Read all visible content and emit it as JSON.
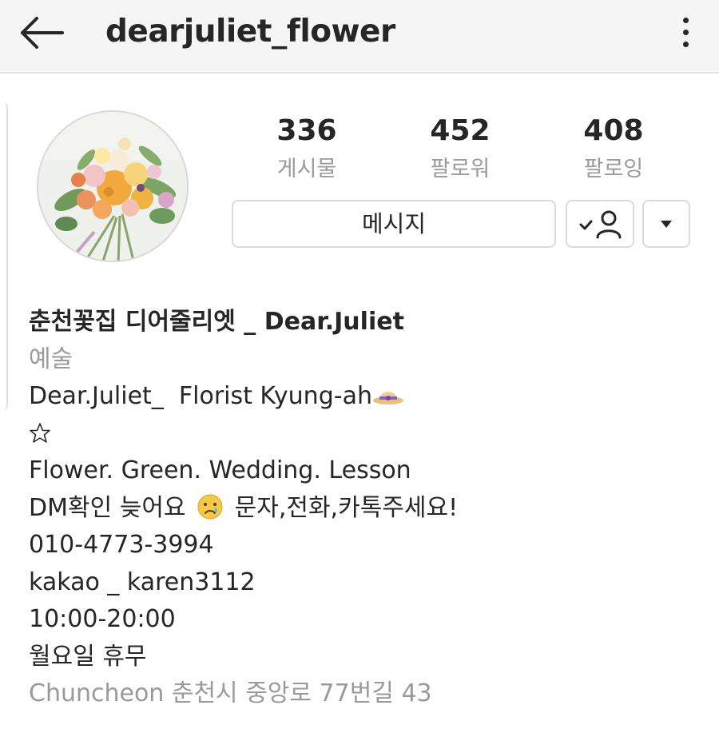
{
  "header": {
    "username": "dearjuliet_flower",
    "back_icon": "arrow-left-icon",
    "more_icon": "more-vertical-icon"
  },
  "profile": {
    "avatar_desc": "flower bouquet photo",
    "stats": [
      {
        "value": "336",
        "label": "게시물"
      },
      {
        "value": "452",
        "label": "팔로워"
      },
      {
        "value": "408",
        "label": "팔로잉"
      }
    ],
    "message_button": "메시지",
    "following_icon": "person-check-icon",
    "dropdown_icon": "triangle-down-icon"
  },
  "bio": {
    "name": "춘천꽃집 디어줄리엣 _ Dear.Juliet",
    "category": "예술",
    "line1": "Dear.Juliet_  Florist Kyung-ah",
    "hat_emoji_icon": "sun-hat-emoji-icon",
    "star_icon": "star-outline-icon",
    "line3": "Flower. Green. Wedding. Lesson",
    "line4_before": "DM확인 늦어요",
    "crying_emoji_icon": "crying-face-emoji-icon",
    "line4_after": "문자,전화,카톡주세요!",
    "phone": "010-4773-3994",
    "kakao": "kakao _ karen3112",
    "hours": "10:00-20:00",
    "closed": "월요일 휴무",
    "address": "Chuncheon 춘천시 중앙로 77번길 43"
  },
  "colors": {
    "text": "#262626",
    "secondary_text": "#9a9a9a",
    "header_bg": "#f5f5f5",
    "button_border": "#dbdbdb"
  }
}
